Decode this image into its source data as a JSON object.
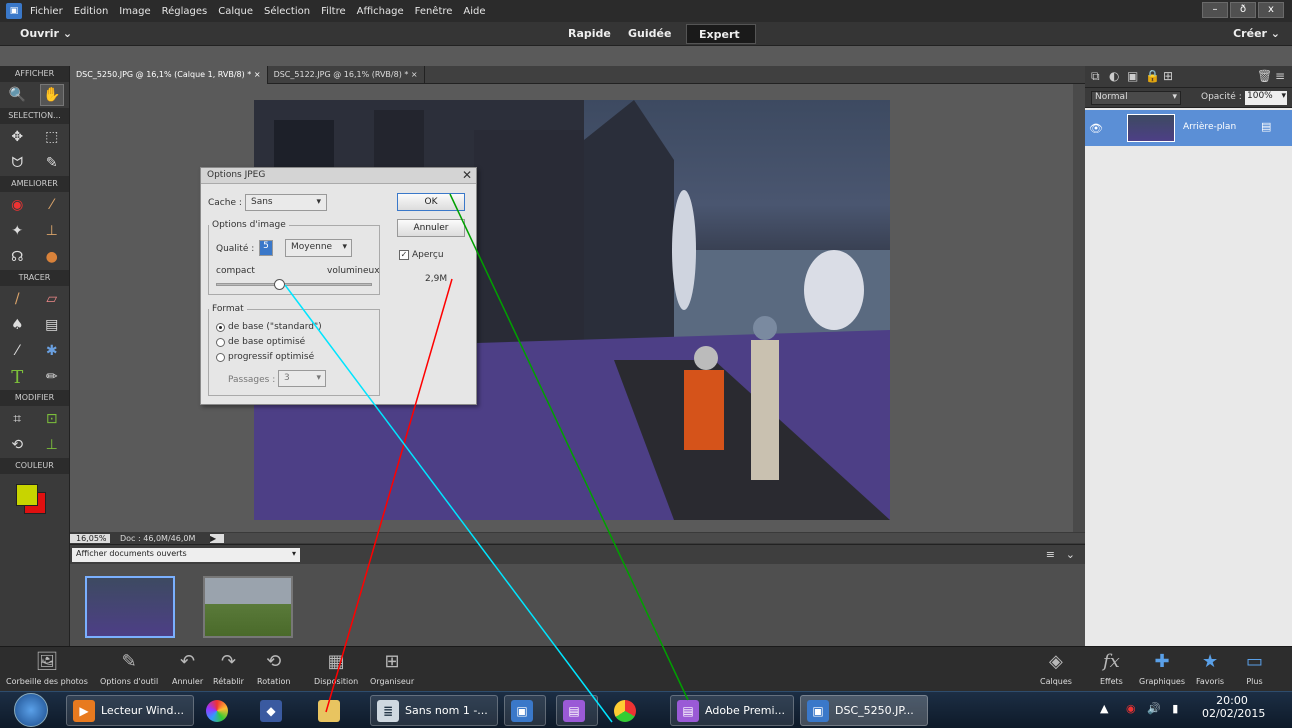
{
  "menubar": {
    "items": [
      "Fichier",
      "Edition",
      "Image",
      "Réglages",
      "Calque",
      "Sélection",
      "Filtre",
      "Affichage",
      "Fenêtre",
      "Aide"
    ],
    "win_minimize": "–",
    "win_restore": "ð",
    "win_close": "x"
  },
  "modebar": {
    "open_label": "Ouvrir",
    "create_label": "Créer",
    "tabs": [
      "Rapide",
      "Guidée",
      "Expert"
    ],
    "active_tab": "Expert"
  },
  "toolbox": {
    "sections": [
      "AFFICHER",
      "SELECTION...",
      "AMELIORER",
      "TRACER",
      "MODIFIER",
      "COULEUR"
    ],
    "foreground_color": "#c8d400",
    "background_color": "#e01010"
  },
  "doc_tabs": [
    {
      "label": "DSC_5250.JPG @ 16,1% (Calque 1, RVB/8) *",
      "close": "×"
    },
    {
      "label": "DSC_5122.JPG @ 16,1% (RVB/8) *",
      "close": "×"
    }
  ],
  "status": {
    "zoom": "16,05%",
    "doc": "Doc : 46,0M/46,0M"
  },
  "photo_bin": {
    "dropdown": "Afficher documents ouverts"
  },
  "layers_panel": {
    "blend_mode": "Normal",
    "opacity_label": "Opacité :",
    "opacity_value": "100%",
    "layer_name": "Arrière-plan"
  },
  "dialog": {
    "title": "Options JPEG",
    "close": "✕",
    "matte_label": "Cache :",
    "matte_value": "Sans",
    "image_options_legend": "Options d'image",
    "quality_label": "Qualité :",
    "quality_value": "5",
    "quality_preset": "Moyenne",
    "compact_label": "compact",
    "large_label": "volumineux",
    "slider_level": 0.4,
    "format_legend": "Format",
    "format_options": [
      "de base (\"standard\")",
      "de base optimisé",
      "progressif optimisé"
    ],
    "format_selected": 0,
    "passes_label": "Passages :",
    "passes_value": "3",
    "ok_label": "OK",
    "cancel_label": "Annuler",
    "preview_label": "Aperçu",
    "file_size": "2,9M"
  },
  "bottombar": {
    "left": [
      "Corbeille des photos",
      "Options d'outil",
      "Annuler",
      "Rétablir",
      "Rotation",
      "Disposition",
      "Organiseur"
    ],
    "right": [
      "Calques",
      "Effets",
      "Graphiques",
      "Favoris",
      "Plus"
    ]
  },
  "taskbar": {
    "items": [
      {
        "label": "Lecteur Wind...",
        "color": "#e87a1f"
      },
      {
        "label": "Sans nom 1 -...",
        "color": "#cfd8e0"
      },
      {
        "label": "Adobe Premi...",
        "color": "#9a5ad6"
      },
      {
        "label": "DSC_5250.JP...",
        "color": "#3a78c9"
      }
    ],
    "time": "20:00",
    "date": "02/02/2015"
  },
  "overlay_colors": {
    "red": "#ff0000",
    "cyan": "#00e5ff",
    "green": "#00a000"
  }
}
